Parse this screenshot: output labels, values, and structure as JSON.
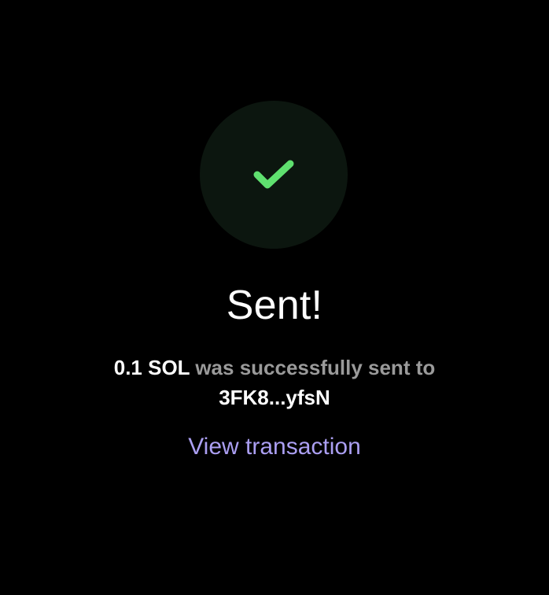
{
  "status": {
    "title": "Sent!",
    "amount": "0.1 SOL",
    "message_middle": " was successfully sent to",
    "recipient": "3FK8...yfsN",
    "link_label": "View transaction"
  },
  "icon": {
    "name": "checkmark-icon"
  },
  "colors": {
    "background": "#000000",
    "circle": "#0c160f",
    "check": "#5fe06f",
    "text": "#ffffff",
    "muted": "#9a9a9a",
    "link": "#ab9ff2"
  }
}
